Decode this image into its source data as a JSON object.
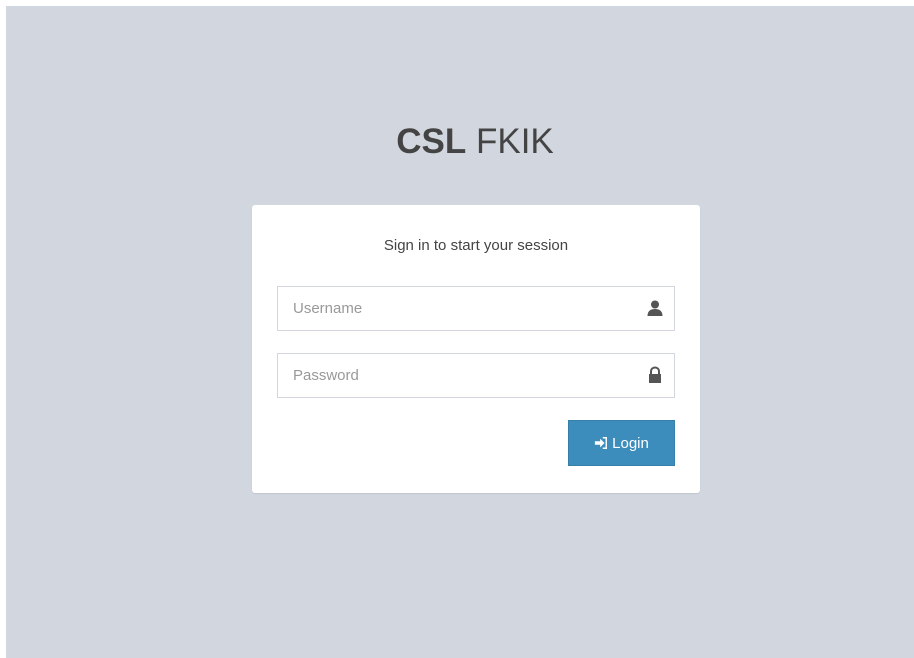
{
  "logo": {
    "bold": "CSL",
    "light": "FKIK"
  },
  "login_box": {
    "message": "Sign in to start your session",
    "username": {
      "placeholder": "Username",
      "value": "",
      "icon": "user-icon"
    },
    "password": {
      "placeholder": "Password",
      "value": "",
      "icon": "lock-icon"
    },
    "submit": {
      "label": "Login",
      "icon": "sign-in-icon"
    }
  },
  "colors": {
    "page_background": "#d2d6de",
    "box_background": "#ffffff",
    "button_primary": "#3c8dbc",
    "text": "#444444",
    "icon": "#555555"
  }
}
